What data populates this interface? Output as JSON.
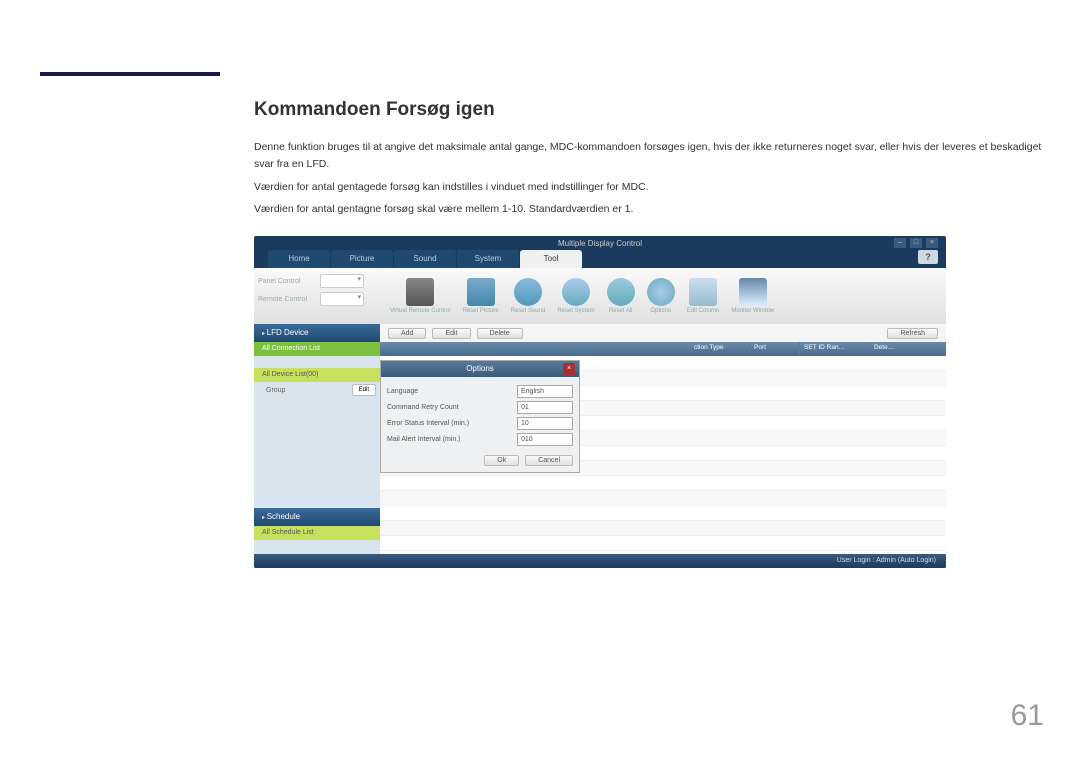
{
  "doc": {
    "title": "Kommandoen Forsøg igen",
    "p1": "Denne funktion bruges til at angive det maksimale antal gange, MDC-kommandoen forsøges igen, hvis der ikke returneres noget svar, eller hvis der leveres et beskadiget svar fra en LFD.",
    "p2": "Værdien for antal gentagede forsøg kan indstilles i vinduet med indstillinger for MDC.",
    "p3": "Værdien for antal gentagne forsøg skal være mellem 1-10. Standardværdien er 1.",
    "page_num": "61"
  },
  "app": {
    "title": "Multiple Display Control",
    "help": "?",
    "tabs": [
      "Home",
      "Picture",
      "Sound",
      "System",
      "Tool"
    ],
    "active_tab": 4,
    "panel_control": "Panel Control",
    "remote_control": "Remote Control",
    "icons": [
      "Virtual Remote Control",
      "Reset Picture",
      "Reset Sound",
      "Reset System",
      "Reset All",
      "Options",
      "Edit Column",
      "Monitor Window"
    ],
    "sidebar": {
      "lfd": "LFD Device",
      "all_conn": "All Connection List",
      "all_dev": "All Device List(00)",
      "group": "Group",
      "edit": "Edit",
      "schedule": "Schedule",
      "all_sched": "All Schedule List"
    },
    "btns": {
      "add": "Add",
      "edit": "Edit",
      "delete": "Delete",
      "refresh": "Refresh"
    },
    "grid_cols": [
      "ction Type",
      "Port",
      "SET ID Ran…",
      "Dete…"
    ],
    "dialog": {
      "title": "Options",
      "language": "Language",
      "language_val": "English",
      "retry": "Command Retry Count",
      "retry_val": "01",
      "error_interval": "Error Status Interval (min.)",
      "error_val": "10",
      "mail_interval": "Mail Alert Interval (min.)",
      "mail_val": "010",
      "ok": "Ok",
      "cancel": "Cancel"
    },
    "status": "User Login : Admin (Auto Login)"
  }
}
